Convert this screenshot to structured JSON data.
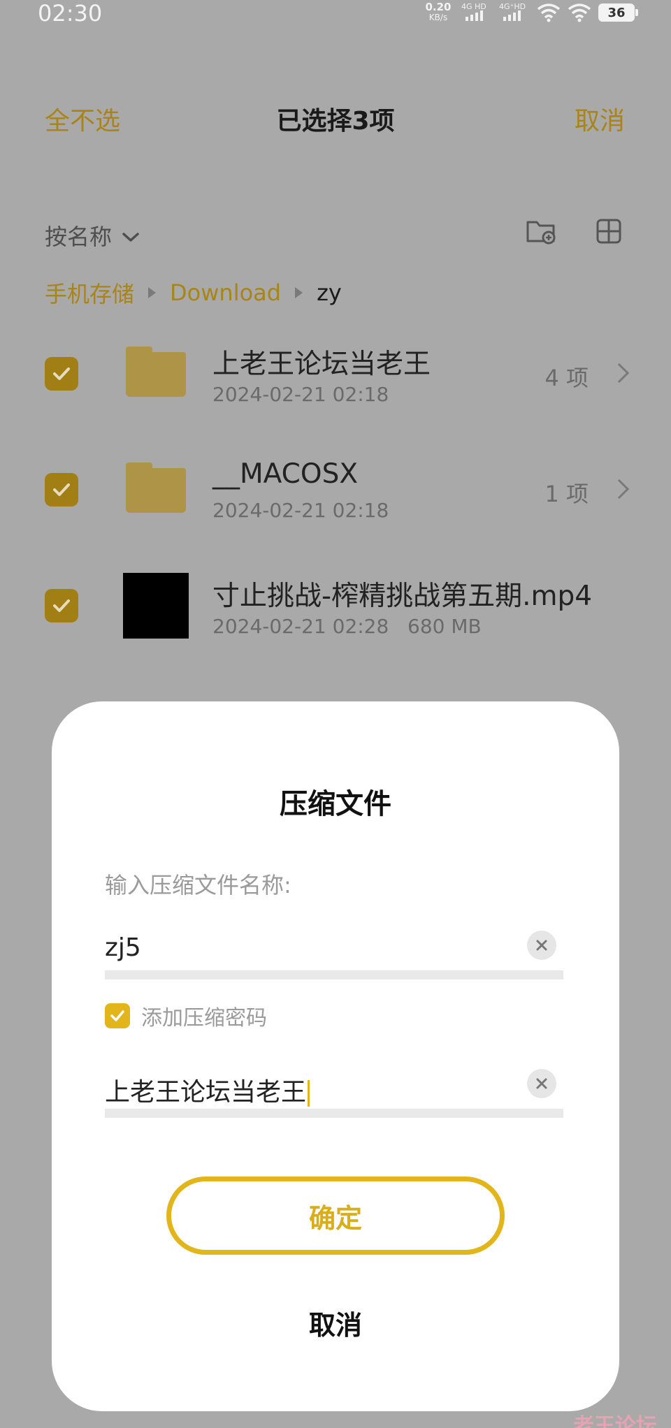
{
  "status": {
    "time": "02:30",
    "net_speed": "0.20",
    "net_unit": "KB/s",
    "sim1": "4G HD",
    "sim2": "4G⁺HD",
    "battery": "36"
  },
  "topbar": {
    "deselect_all": "全不选",
    "title": "已选择3项",
    "cancel": "取消"
  },
  "sort": {
    "label": "按名称"
  },
  "breadcrumb": [
    "手机存储",
    "Download",
    "zy"
  ],
  "files": [
    {
      "name": "上老王论坛当老王",
      "date": "2024-02-21 02:18",
      "count": "4 项",
      "type": "folder"
    },
    {
      "name": "__MACOSX",
      "date": "2024-02-21 02:18",
      "count": "1 项",
      "type": "folder"
    },
    {
      "name": "寸止挑战-榨精挑战第五期.mp4",
      "date": "2024-02-21 02:28",
      "size": "680 MB",
      "type": "video"
    }
  ],
  "dialog": {
    "title": "压缩文件",
    "name_label": "输入压缩文件名称:",
    "name_value": "zj5",
    "password_checkbox_label": "添加压缩密码",
    "password_value": "上老王论坛当老王",
    "confirm": "确定",
    "cancel": "取消"
  },
  "watermark": "老王论坛",
  "colors": {
    "accent": "#e2b51a",
    "accent_dim": "#a88419",
    "overlay": "#a9a9a9"
  }
}
